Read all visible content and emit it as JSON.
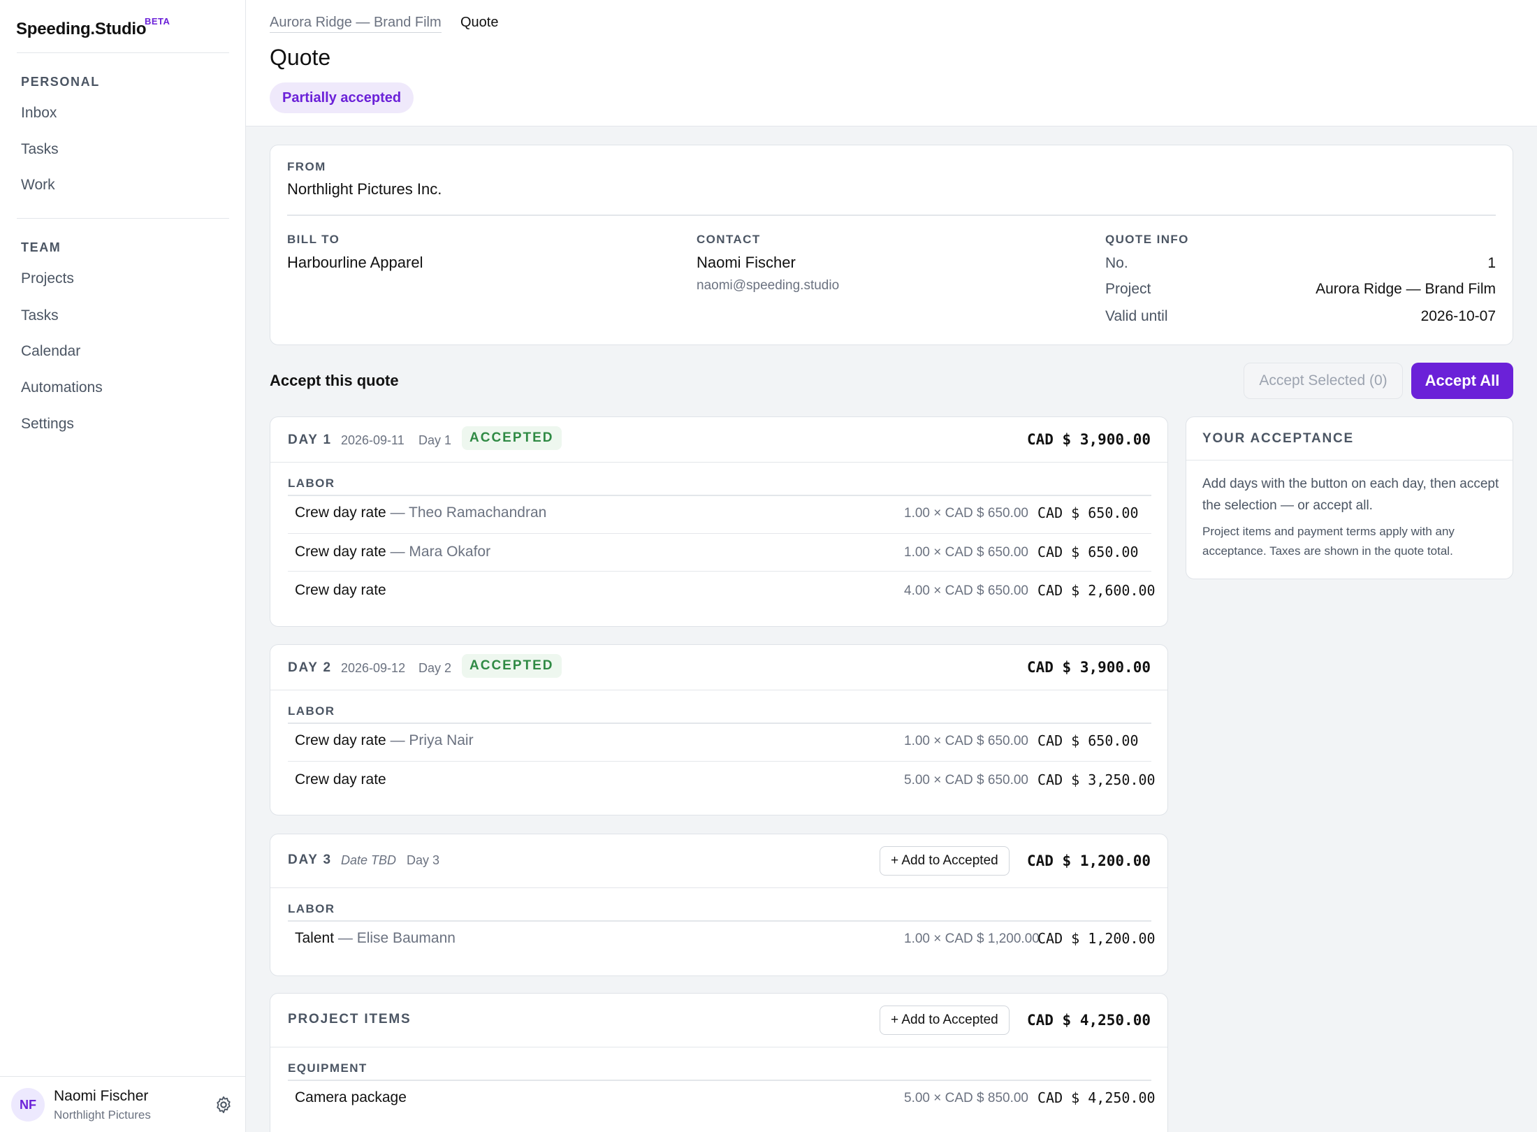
{
  "app": {
    "name": "Speeding.Studio",
    "badge": "BETA"
  },
  "sidebar": {
    "personal_heading": "PERSONAL",
    "personal_items": [
      "Inbox",
      "Tasks",
      "Work"
    ],
    "team_heading": "TEAM",
    "team_items": [
      "Projects",
      "Tasks",
      "Calendar",
      "Automations",
      "Settings"
    ],
    "user": {
      "initials": "NF",
      "name": "Naomi Fischer",
      "org": "Northlight Pictures"
    }
  },
  "header": {
    "breadcrumb": [
      "Aurora Ridge — Brand Film",
      "Quote"
    ],
    "title": "Quote",
    "status": "Partially accepted"
  },
  "quote": {
    "from_label": "FROM",
    "from": "Northlight Pictures Inc.",
    "bill_to_label": "BILL TO",
    "bill_to": "Harbourline Apparel",
    "contact_label": "CONTACT",
    "contact_name": "Naomi Fischer",
    "contact_email": "naomi@speeding.studio",
    "info_label": "QUOTE INFO",
    "info": [
      {
        "key": "No.",
        "value": "1"
      },
      {
        "key": "Project",
        "value": "Aurora Ridge — Brand Film"
      },
      {
        "key": "Valid until",
        "value": "2026-10-07"
      }
    ]
  },
  "accept": {
    "title": "Accept this quote",
    "accept_selected": "Accept Selected (0)",
    "accept_all": "Accept All"
  },
  "days": [
    {
      "num": "DAY 1",
      "date": "2026-09-11",
      "label": "Day 1",
      "status": "ACCEPTED",
      "total": "CAD $ 3,900.00",
      "section": "LABOR",
      "items": [
        {
          "name": "Crew day rate — Theo Ramachandran",
          "who": "— Theo Ramachandran",
          "qty": "1.00 × CAD $ 650.00",
          "amount": "CAD $ 650.00"
        },
        {
          "name": "Crew day rate — Mara Okafor",
          "who": "— Mara Okafor",
          "qty": "1.00 × CAD $ 650.00",
          "amount": "CAD $ 650.00"
        },
        {
          "name": "Crew day rate",
          "who": "",
          "qty": "4.00 × CAD $ 650.00",
          "amount": "CAD $ 2,600.00"
        }
      ]
    },
    {
      "num": "DAY 2",
      "date": "2026-09-12",
      "label": "Day 2",
      "status": "ACCEPTED",
      "total": "CAD $ 3,900.00",
      "section": "LABOR",
      "items": [
        {
          "name": "Crew day rate — Priya Nair",
          "who": "— Priya Nair",
          "qty": "1.00 × CAD $ 650.00",
          "amount": "CAD $ 650.00"
        },
        {
          "name": "Crew day rate",
          "who": "",
          "qty": "5.00 × CAD $ 650.00",
          "amount": "CAD $ 3,250.00"
        }
      ]
    },
    {
      "num": "DAY 3",
      "date": "Date TBD",
      "label": "Day 3",
      "action": "+ Add to Accepted",
      "total": "CAD $ 1,200.00",
      "section": "LABOR",
      "items": [
        {
          "name": "Talent — Elise Baumann",
          "who": "— Elise Baumann",
          "qty": "1.00 × CAD $ 1,200.00",
          "amount": "CAD $ 1,200.00"
        }
      ]
    }
  ],
  "project_items": {
    "title": "PROJECT ITEMS",
    "action": "+ Add to Accepted",
    "total": "CAD $ 4,250.00",
    "section": "EQUIPMENT",
    "items": [
      {
        "name": "Camera package",
        "qty": "5.00 × CAD $ 850.00",
        "amount": "CAD $ 4,250.00"
      }
    ]
  },
  "your_acceptance": {
    "title": "YOUR ACCEPTANCE",
    "p1": "Add days with the button on each day, then accept the selection — or accept all.",
    "p2": "Project items and payment terms apply with any acceptance. Taxes are shown in the quote total."
  },
  "colors": {
    "accent": "#6b21d8",
    "accepted": "#2f8a44",
    "background": "#f2f4f6"
  }
}
